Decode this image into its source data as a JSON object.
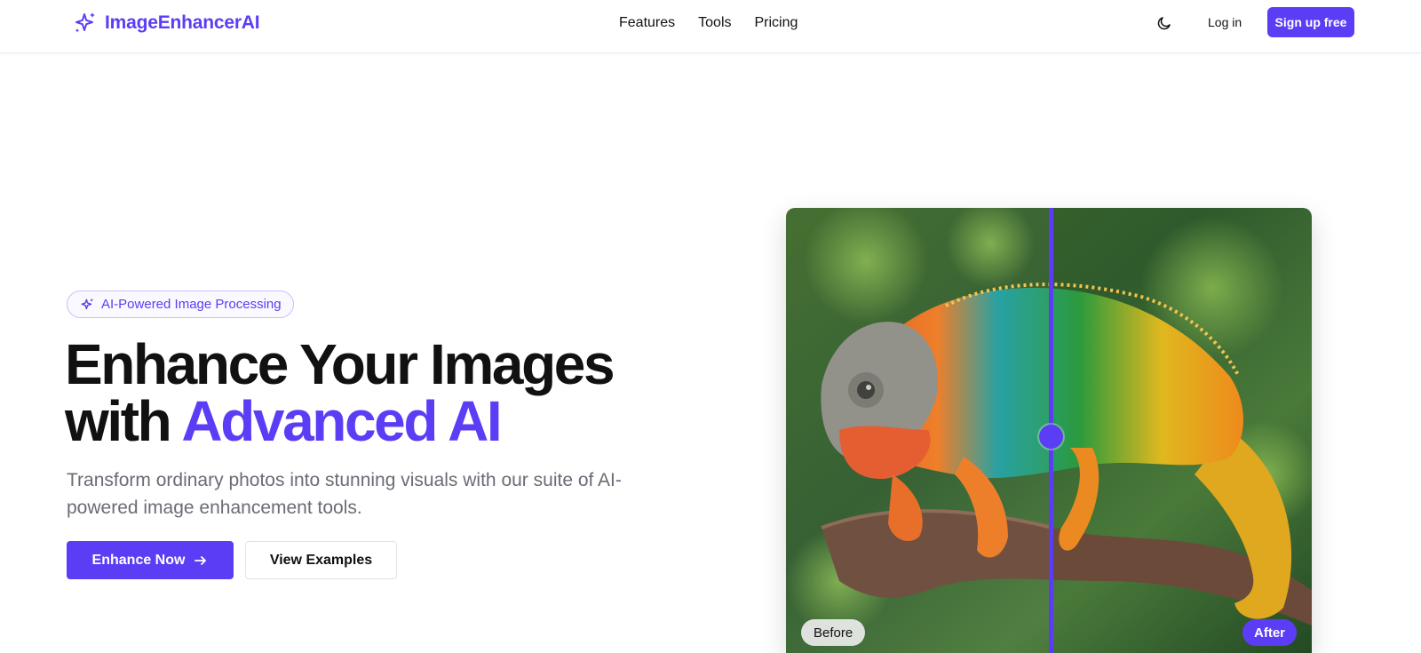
{
  "header": {
    "brand_name": "ImageEnhancerAI",
    "brand_icon": "sparkles-icon",
    "nav": [
      "Features",
      "Tools",
      "Pricing"
    ],
    "theme_toggle_icon": "moon-icon",
    "login_label": "Log in",
    "signup_label": "Sign up free"
  },
  "hero": {
    "badge_icon": "sparkles-icon",
    "badge_text": "AI-Powered Image Processing",
    "headline_line1": "Enhance Your Images",
    "headline_line2_prefix": "with ",
    "headline_accent": "Advanced AI",
    "subtitle": "Transform ordinary photos into stunning visuals with our suite of AI-powered image enhancement tools.",
    "primary_button": "Enhance Now",
    "primary_button_icon": "arrow-right-icon",
    "secondary_button": "View Examples"
  },
  "comparison": {
    "before_label": "Before",
    "after_label": "After",
    "slider_position": 0.5,
    "image_subject": "chameleon-photo"
  },
  "colors": {
    "accent": "#5b3df5",
    "text": "#111111",
    "muted": "#6b6b76"
  }
}
